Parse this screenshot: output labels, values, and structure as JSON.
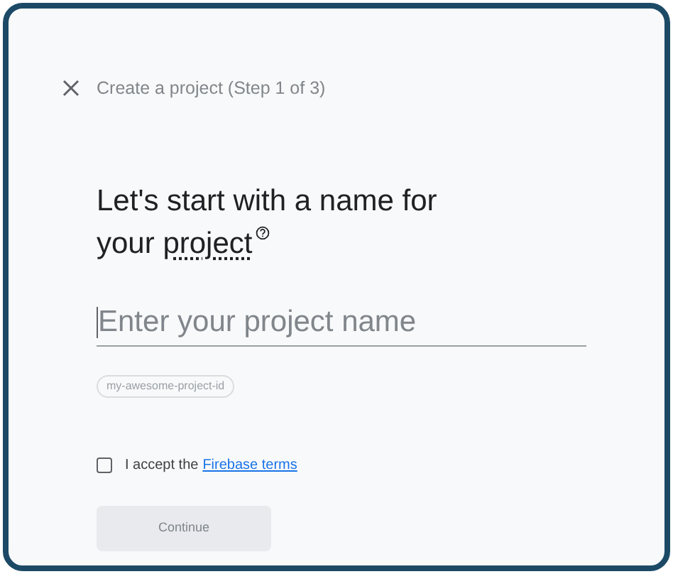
{
  "header": {
    "title": "Create a project (Step 1 of 3)"
  },
  "heading_lines": [
    {
      "text": "Let's start with a name for"
    },
    {
      "text": "your",
      "term": "project"
    }
  ],
  "project_name": {
    "placeholder": "Enter your project name"
  },
  "project_id": {
    "placeholder": "my-awesome-project-id"
  },
  "terms": {
    "checked": false,
    "text": "I accept the",
    "link": "Firebase terms"
  },
  "continue_button": {
    "label": "Continue",
    "disabled": true
  }
}
